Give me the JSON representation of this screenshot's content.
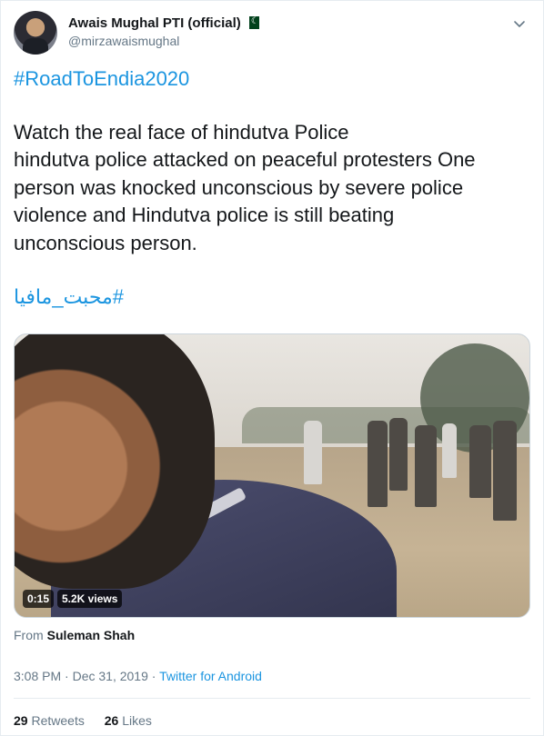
{
  "author": {
    "display_name": "Awais Mughal PTI (official)",
    "handle": "@mirzawaismughal"
  },
  "tweet": {
    "hashtag_top": "#RoadToEndia2020",
    "lines": [
      "Watch the real face of hindutva Police",
      "hindutva police attacked on peaceful protesters One",
      "person was knocked unconscious by severe police",
      "violence and Hindutva police is still beating",
      "unconscious person."
    ],
    "hashtag_urdu": "#محبت_مافیا"
  },
  "media": {
    "duration": "0:15",
    "views": "5.2K views"
  },
  "attribution": {
    "prefix": "From",
    "name": "Suleman Shah"
  },
  "meta": {
    "time": "3:08 PM",
    "separator": " · ",
    "date": "Dec 31, 2019",
    "client": "Twitter for Android"
  },
  "stats": {
    "retweets_count": "29",
    "retweets_label": "Retweets",
    "likes_count": "26",
    "likes_label": "Likes"
  },
  "icons": {
    "flag": "pakistan-flag-icon",
    "menu": "chevron-down-icon"
  },
  "colors": {
    "link": "#1b95e0",
    "text": "#14171a",
    "secondary": "#657786"
  }
}
